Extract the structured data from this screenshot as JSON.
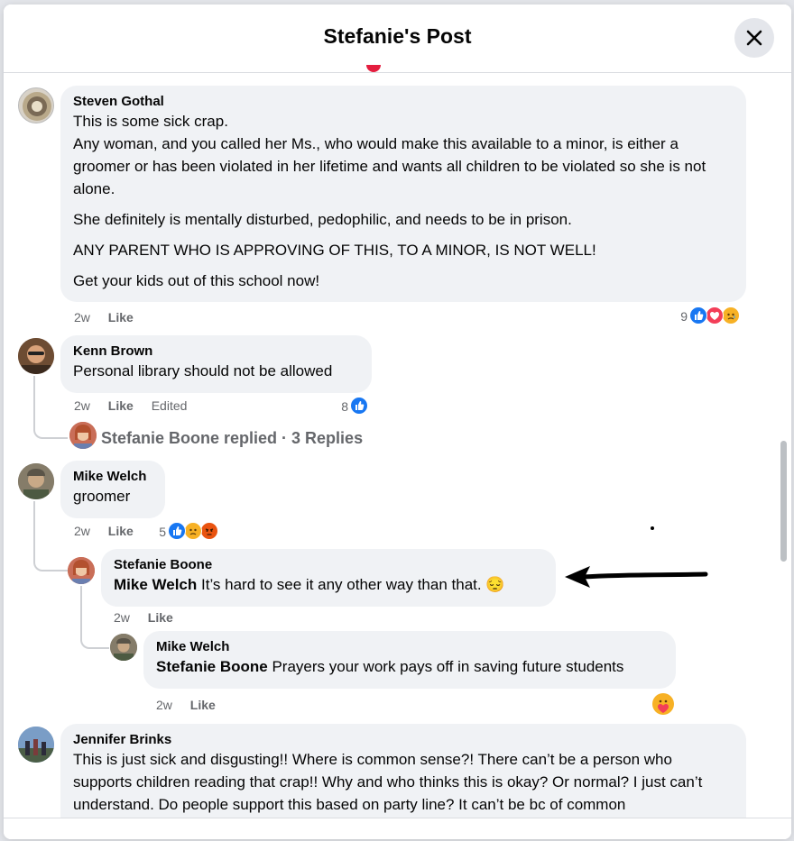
{
  "header": {
    "title": "Stefanie's Post",
    "close_icon": "close-icon"
  },
  "colors": {
    "like": "#1877f2",
    "love": "#f33e58",
    "sad": "#f7b125",
    "angry": "#e9710f",
    "meta": "#65676b"
  },
  "comments": [
    {
      "author": "Steven Gothal",
      "paragraphs": [
        "This is some sick crap.\nAny woman, and you called her Ms., who would make this available to a minor, is either a groomer or has been violated in her lifetime and wants all children to be violated so she is not alone.",
        "She definitely is mentally disturbed, pedophilic, and needs to be in prison.",
        "ANY PARENT WHO IS APPROVING OF THIS, TO A MINOR, IS NOT WELL!",
        "Get your kids out of this school now!"
      ],
      "time": "2w",
      "like": "Like",
      "reaction_count": "9",
      "reactions": [
        "like-icon",
        "love-icon",
        "sad-icon"
      ]
    },
    {
      "author": "Kenn Brown",
      "text": "Personal library should not be allowed",
      "time": "2w",
      "like": "Like",
      "edited": "Edited",
      "reaction_count": "8",
      "reactions": [
        "like-icon"
      ],
      "replies_summary": "Stefanie Boone replied · 3 Replies"
    },
    {
      "author": "Mike Welch",
      "text": "groomer",
      "time": "2w",
      "like": "Like",
      "reaction_count": "5",
      "reactions": [
        "like-icon",
        "sad-icon",
        "angry-icon"
      ],
      "replies": [
        {
          "author": "Stefanie Boone",
          "mention": "Mike Welch",
          "text": " It’s hard to see it any other way than that. 😔",
          "time": "2w",
          "like": "Like"
        },
        {
          "author": "Mike Welch",
          "mention": "Stefanie Boone",
          "text": " Prayers your work pays off in saving future students",
          "time": "2w",
          "like": "Like",
          "reactions": [
            "care-icon"
          ]
        }
      ]
    },
    {
      "author": "Jennifer Brinks",
      "text": "This is just sick and disgusting!! Where is common sense?! There can’t be a person who supports children reading that crap!! Why and who thinks this is okay? Or normal? I just can’t understand. Do people support this based on party line? It can’t be bc of common"
    }
  ]
}
